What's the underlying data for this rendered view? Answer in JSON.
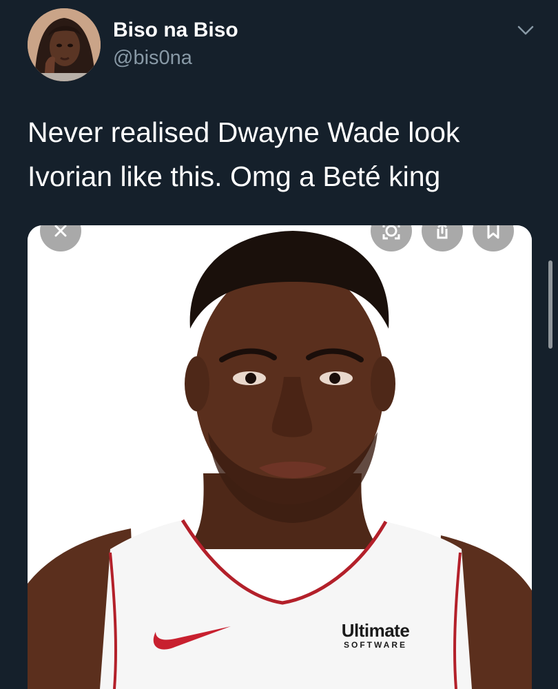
{
  "tweet": {
    "display_name": "Biso na Biso",
    "handle": "@bis0na",
    "text": "Never realised Dwayne Wade look\nIvorian like this. Omg a Beté king"
  },
  "media": {
    "jersey_logo_line1": "Ultimate",
    "jersey_logo_line2": "SOFTWARE",
    "overlay_icons": [
      "close-icon",
      "lens-icon",
      "share-icon",
      "bookmark-icon"
    ]
  },
  "colors": {
    "background": "#15202b",
    "secondary_text": "#8899a6",
    "jersey_trim": "#b3202a",
    "swoosh": "#c8202f"
  }
}
